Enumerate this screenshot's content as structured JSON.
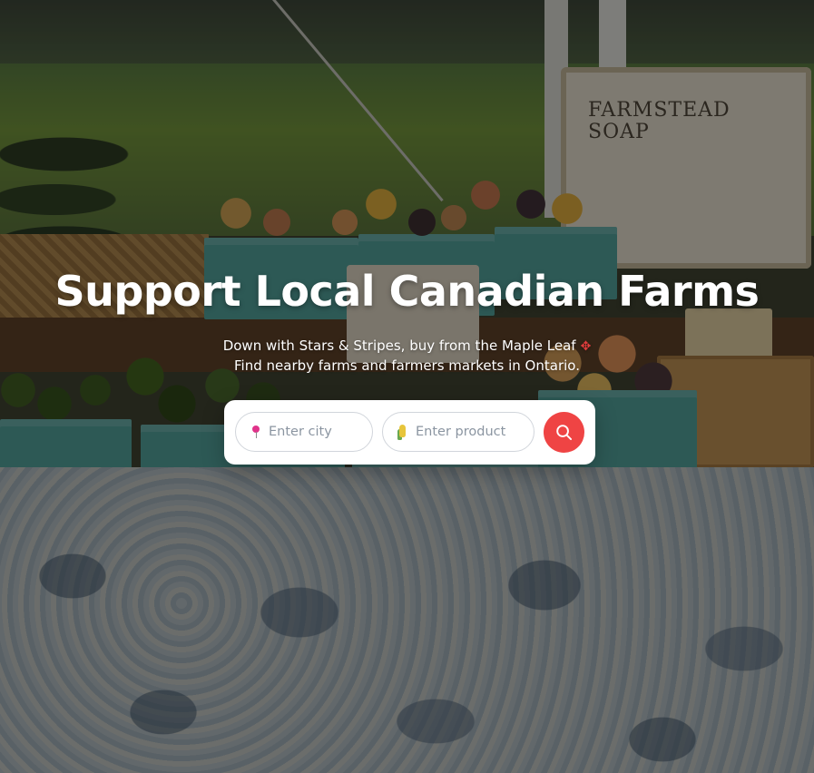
{
  "hero": {
    "title": "Support Local Canadian Farms",
    "subtitle_line1": "Down with Stars & Stripes, buy from the Maple Leaf",
    "subtitle_line2": "Find nearby farms and farmers markets in Ontario.",
    "maple_icon": "maple-leaf-icon"
  },
  "background": {
    "sign_title": "FARMSTEAD SOAP",
    "description": "farmers market stand photo with produce baskets"
  },
  "search": {
    "city_placeholder": "Enter city",
    "city_icon": "pushpin-icon",
    "product_placeholder": "Enter product",
    "product_icon": "corn-icon",
    "button_icon": "search-icon"
  },
  "colors": {
    "accent": "#ef4444",
    "overlay": "rgba(0,0,0,0.42)",
    "card": "#ffffff"
  }
}
